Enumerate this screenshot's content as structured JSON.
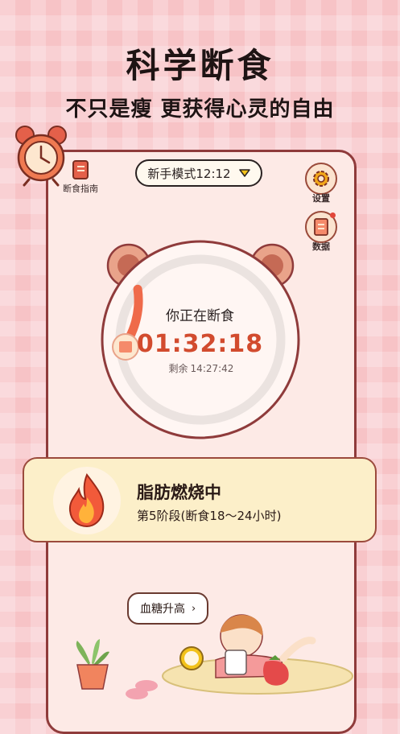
{
  "headline": "科学断食",
  "subline": "不只是瘦 更获得心灵的自由",
  "toolbar": {
    "guide_label": "断食指南",
    "mode_label": "新手模式12:12",
    "settings_label": "设置",
    "data_label": "数据"
  },
  "timer": {
    "status": "你正在断食",
    "elapsed": "01:32:18",
    "remaining_label": "剩余",
    "remaining": "14:27:42",
    "progress": 0.1
  },
  "stage": {
    "title": "脂肪燃烧中",
    "subtitle": "第5阶段(断食18～24小时)"
  },
  "tip": {
    "label": "血糖升高"
  },
  "colors": {
    "accent": "#d24b2e",
    "progress": "#ef6a4a",
    "background": "#f7c3c6",
    "card": "#fcefc9"
  }
}
